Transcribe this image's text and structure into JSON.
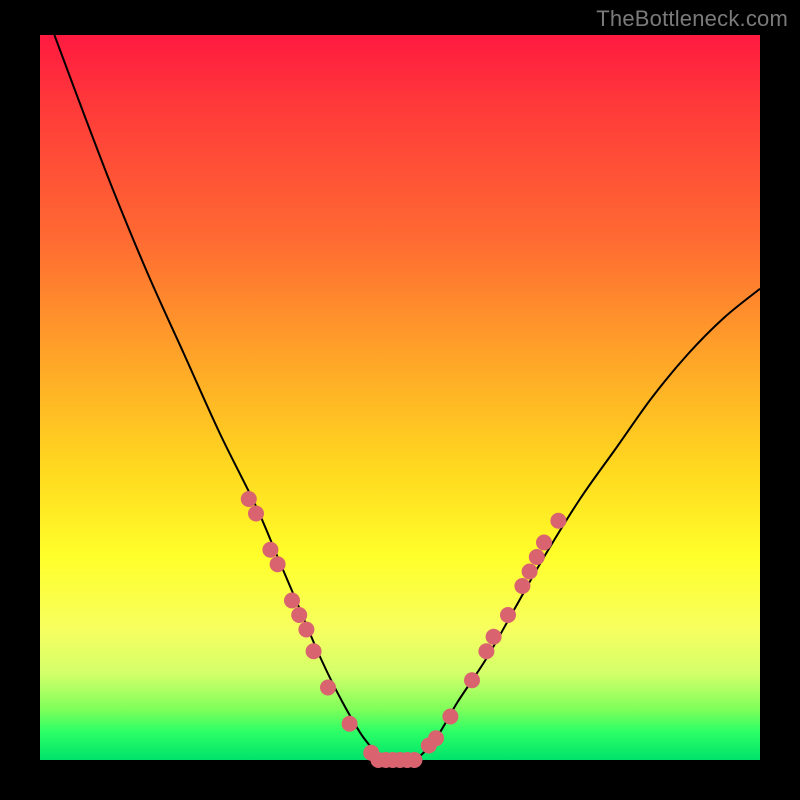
{
  "watermark": "TheBottleneck.com",
  "colors": {
    "frame": "#000000",
    "curve": "#000000",
    "marker": "#d9636e",
    "gradient_top": "#ff1a40",
    "gradient_bottom": "#00e36b"
  },
  "chart_data": {
    "type": "line",
    "title": "",
    "xlabel": "",
    "ylabel": "",
    "xlim": [
      0,
      100
    ],
    "ylim": [
      0,
      100
    ],
    "series": [
      {
        "name": "bottleneck-curve",
        "x": [
          2,
          5,
          10,
          15,
          20,
          25,
          30,
          33,
          36,
          39,
          42,
          45,
          48,
          50,
          52,
          55,
          58,
          62,
          66,
          70,
          75,
          80,
          85,
          90,
          95,
          100
        ],
        "y": [
          100,
          92,
          79,
          67,
          56,
          45,
          35,
          28,
          21,
          14,
          8,
          3,
          0,
          0,
          0,
          3,
          8,
          14,
          21,
          28,
          36,
          43,
          50,
          56,
          61,
          65
        ]
      }
    ],
    "markers": [
      {
        "x": 29,
        "y": 36
      },
      {
        "x": 30,
        "y": 34
      },
      {
        "x": 32,
        "y": 29
      },
      {
        "x": 33,
        "y": 27
      },
      {
        "x": 35,
        "y": 22
      },
      {
        "x": 36,
        "y": 20
      },
      {
        "x": 37,
        "y": 18
      },
      {
        "x": 38,
        "y": 15
      },
      {
        "x": 40,
        "y": 10
      },
      {
        "x": 43,
        "y": 5
      },
      {
        "x": 46,
        "y": 1
      },
      {
        "x": 47,
        "y": 0
      },
      {
        "x": 48,
        "y": 0
      },
      {
        "x": 49,
        "y": 0
      },
      {
        "x": 50,
        "y": 0
      },
      {
        "x": 51,
        "y": 0
      },
      {
        "x": 52,
        "y": 0
      },
      {
        "x": 54,
        "y": 2
      },
      {
        "x": 55,
        "y": 3
      },
      {
        "x": 57,
        "y": 6
      },
      {
        "x": 60,
        "y": 11
      },
      {
        "x": 62,
        "y": 15
      },
      {
        "x": 63,
        "y": 17
      },
      {
        "x": 65,
        "y": 20
      },
      {
        "x": 67,
        "y": 24
      },
      {
        "x": 68,
        "y": 26
      },
      {
        "x": 69,
        "y": 28
      },
      {
        "x": 70,
        "y": 30
      },
      {
        "x": 72,
        "y": 33
      }
    ],
    "gradient_stops": [
      {
        "pos": 0,
        "color": "#ff1a40"
      },
      {
        "pos": 10,
        "color": "#ff3a3a"
      },
      {
        "pos": 28,
        "color": "#ff6a32"
      },
      {
        "pos": 45,
        "color": "#ffa628"
      },
      {
        "pos": 60,
        "color": "#ffd91f"
      },
      {
        "pos": 72,
        "color": "#ffff2a"
      },
      {
        "pos": 82,
        "color": "#f7ff60"
      },
      {
        "pos": 88,
        "color": "#d4ff6a"
      },
      {
        "pos": 93,
        "color": "#7fff5a"
      },
      {
        "pos": 96,
        "color": "#2eff66"
      },
      {
        "pos": 100,
        "color": "#00e36b"
      }
    ]
  }
}
